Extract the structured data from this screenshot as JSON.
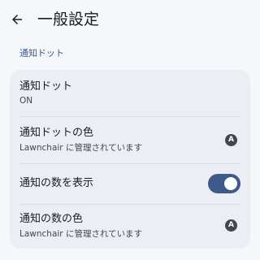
{
  "header": {
    "title": "一般設定",
    "back_icon": "arrow-left-icon"
  },
  "section": {
    "title": "通知ドット"
  },
  "settings": [
    {
      "title": "通知ドット",
      "subtitle": "ON"
    },
    {
      "title": "通知ドットの色",
      "subtitle": "Lawnchair に管理されています",
      "badge": "A"
    },
    {
      "title": "通知の数を表示",
      "toggle_on": true
    },
    {
      "title": "通知の数の色",
      "subtitle": "Lawnchair に管理されています",
      "badge": "A"
    }
  ],
  "colors": {
    "accent": "#3f5a8c",
    "section_header": "#3d5a8a",
    "card_bg": "#edeef4",
    "page_bg": "#f6f7fb"
  }
}
